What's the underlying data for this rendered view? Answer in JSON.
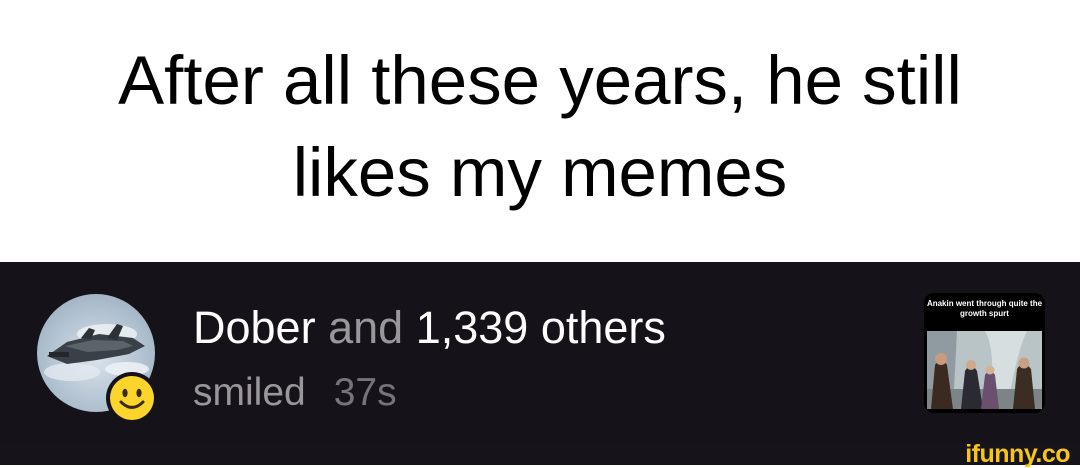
{
  "caption": {
    "line1": "After all these years, he still",
    "line2": "likes my memes"
  },
  "notification": {
    "user_name": "Dober",
    "conjunction": "and",
    "others_count": "1,339 others",
    "action": "smiled",
    "time_ago": "37s",
    "reaction_icon": "smile-emoji-icon",
    "thumbnail_caption": "Anakin went through quite the growth spurt"
  },
  "brand": {
    "name": "ifunny.co",
    "color": "#f5c518"
  },
  "colors": {
    "panel_background": "#161219",
    "muted_text": "#9a979c",
    "emoji_yellow": "#fcd52c"
  }
}
